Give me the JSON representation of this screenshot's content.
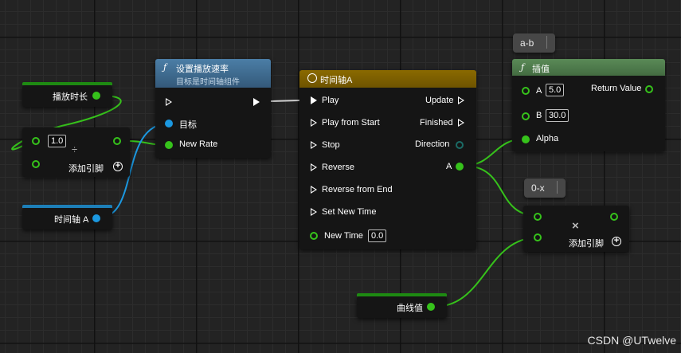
{
  "nodes": {
    "play_duration": {
      "label": "播放时长"
    },
    "divide": {
      "a_value": "1.0",
      "op": "÷",
      "add_pin": "添加引脚",
      "add_icon": "+"
    },
    "timeline_a_var": {
      "label": "时间轴 A"
    },
    "set_play_rate": {
      "title": "设置播放速率",
      "subtitle": "目标是时间轴组件",
      "func_icon": "ƒ",
      "pins": {
        "target": "目标",
        "new_rate": "New Rate"
      }
    },
    "timeline_a": {
      "title": "时间轴A",
      "inputs": [
        "Play",
        "Play from Start",
        "Stop",
        "Reverse",
        "Reverse from End",
        "Set New Time"
      ],
      "new_time_label": "New Time",
      "new_time_value": "0.0",
      "outputs": {
        "update": "Update",
        "finished": "Finished",
        "direction": "Direction",
        "a": "A"
      }
    },
    "lerp": {
      "title": "插值",
      "func_icon": "ƒ",
      "a_label": "A",
      "a_value": "5.0",
      "b_label": "B",
      "b_value": "30.0",
      "alpha_label": "Alpha",
      "return_label": "Return Value"
    },
    "multiply": {
      "op": "×",
      "add_pin": "添加引脚",
      "add_icon": "+"
    },
    "curve_value": {
      "label": "曲线值"
    }
  },
  "tags": {
    "ab": "a-b",
    "ox": "0-x"
  },
  "colors": {
    "graph_bg": "#232323",
    "float_pin": "#36c21b",
    "object_pin": "#1b98e0",
    "timeline_header": "#7f6200",
    "lerp_header": "#4e7a4c",
    "set_rate_header": "#3f6b8f"
  },
  "watermark": "CSDN @UTwelve"
}
